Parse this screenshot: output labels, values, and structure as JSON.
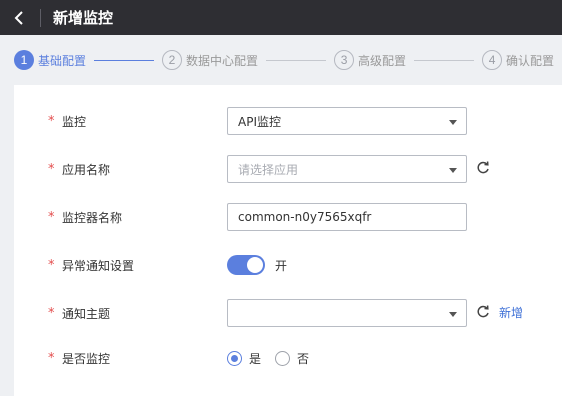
{
  "header": {
    "title": "新增监控"
  },
  "stepper": {
    "steps": [
      {
        "number": "1",
        "label": "基础配置",
        "active": true
      },
      {
        "number": "2",
        "label": "数据中心配置",
        "active": false
      },
      {
        "number": "3",
        "label": "高级配置",
        "active": false
      },
      {
        "number": "4",
        "label": "确认配置",
        "active": false
      }
    ]
  },
  "form": {
    "monitor": {
      "label": "监控",
      "value": "API监控"
    },
    "app_name": {
      "label": "应用名称",
      "placeholder": "请选择应用"
    },
    "monitor_name": {
      "label": "监控器名称",
      "value": "common-n0y7565xqfr"
    },
    "alert_setting": {
      "label": "异常通知设置",
      "toggle_on": true,
      "toggle_text": "开"
    },
    "topic": {
      "label": "通知主题",
      "value": "",
      "add_label": "新增"
    },
    "enable_monitor": {
      "label": "是否监控",
      "options": [
        "是",
        "否"
      ],
      "selected": "是"
    }
  },
  "colors": {
    "accent": "#5b7fde",
    "header_bg": "#2e2e33",
    "required": "#e34d4d",
    "link": "#3d6fd6"
  }
}
